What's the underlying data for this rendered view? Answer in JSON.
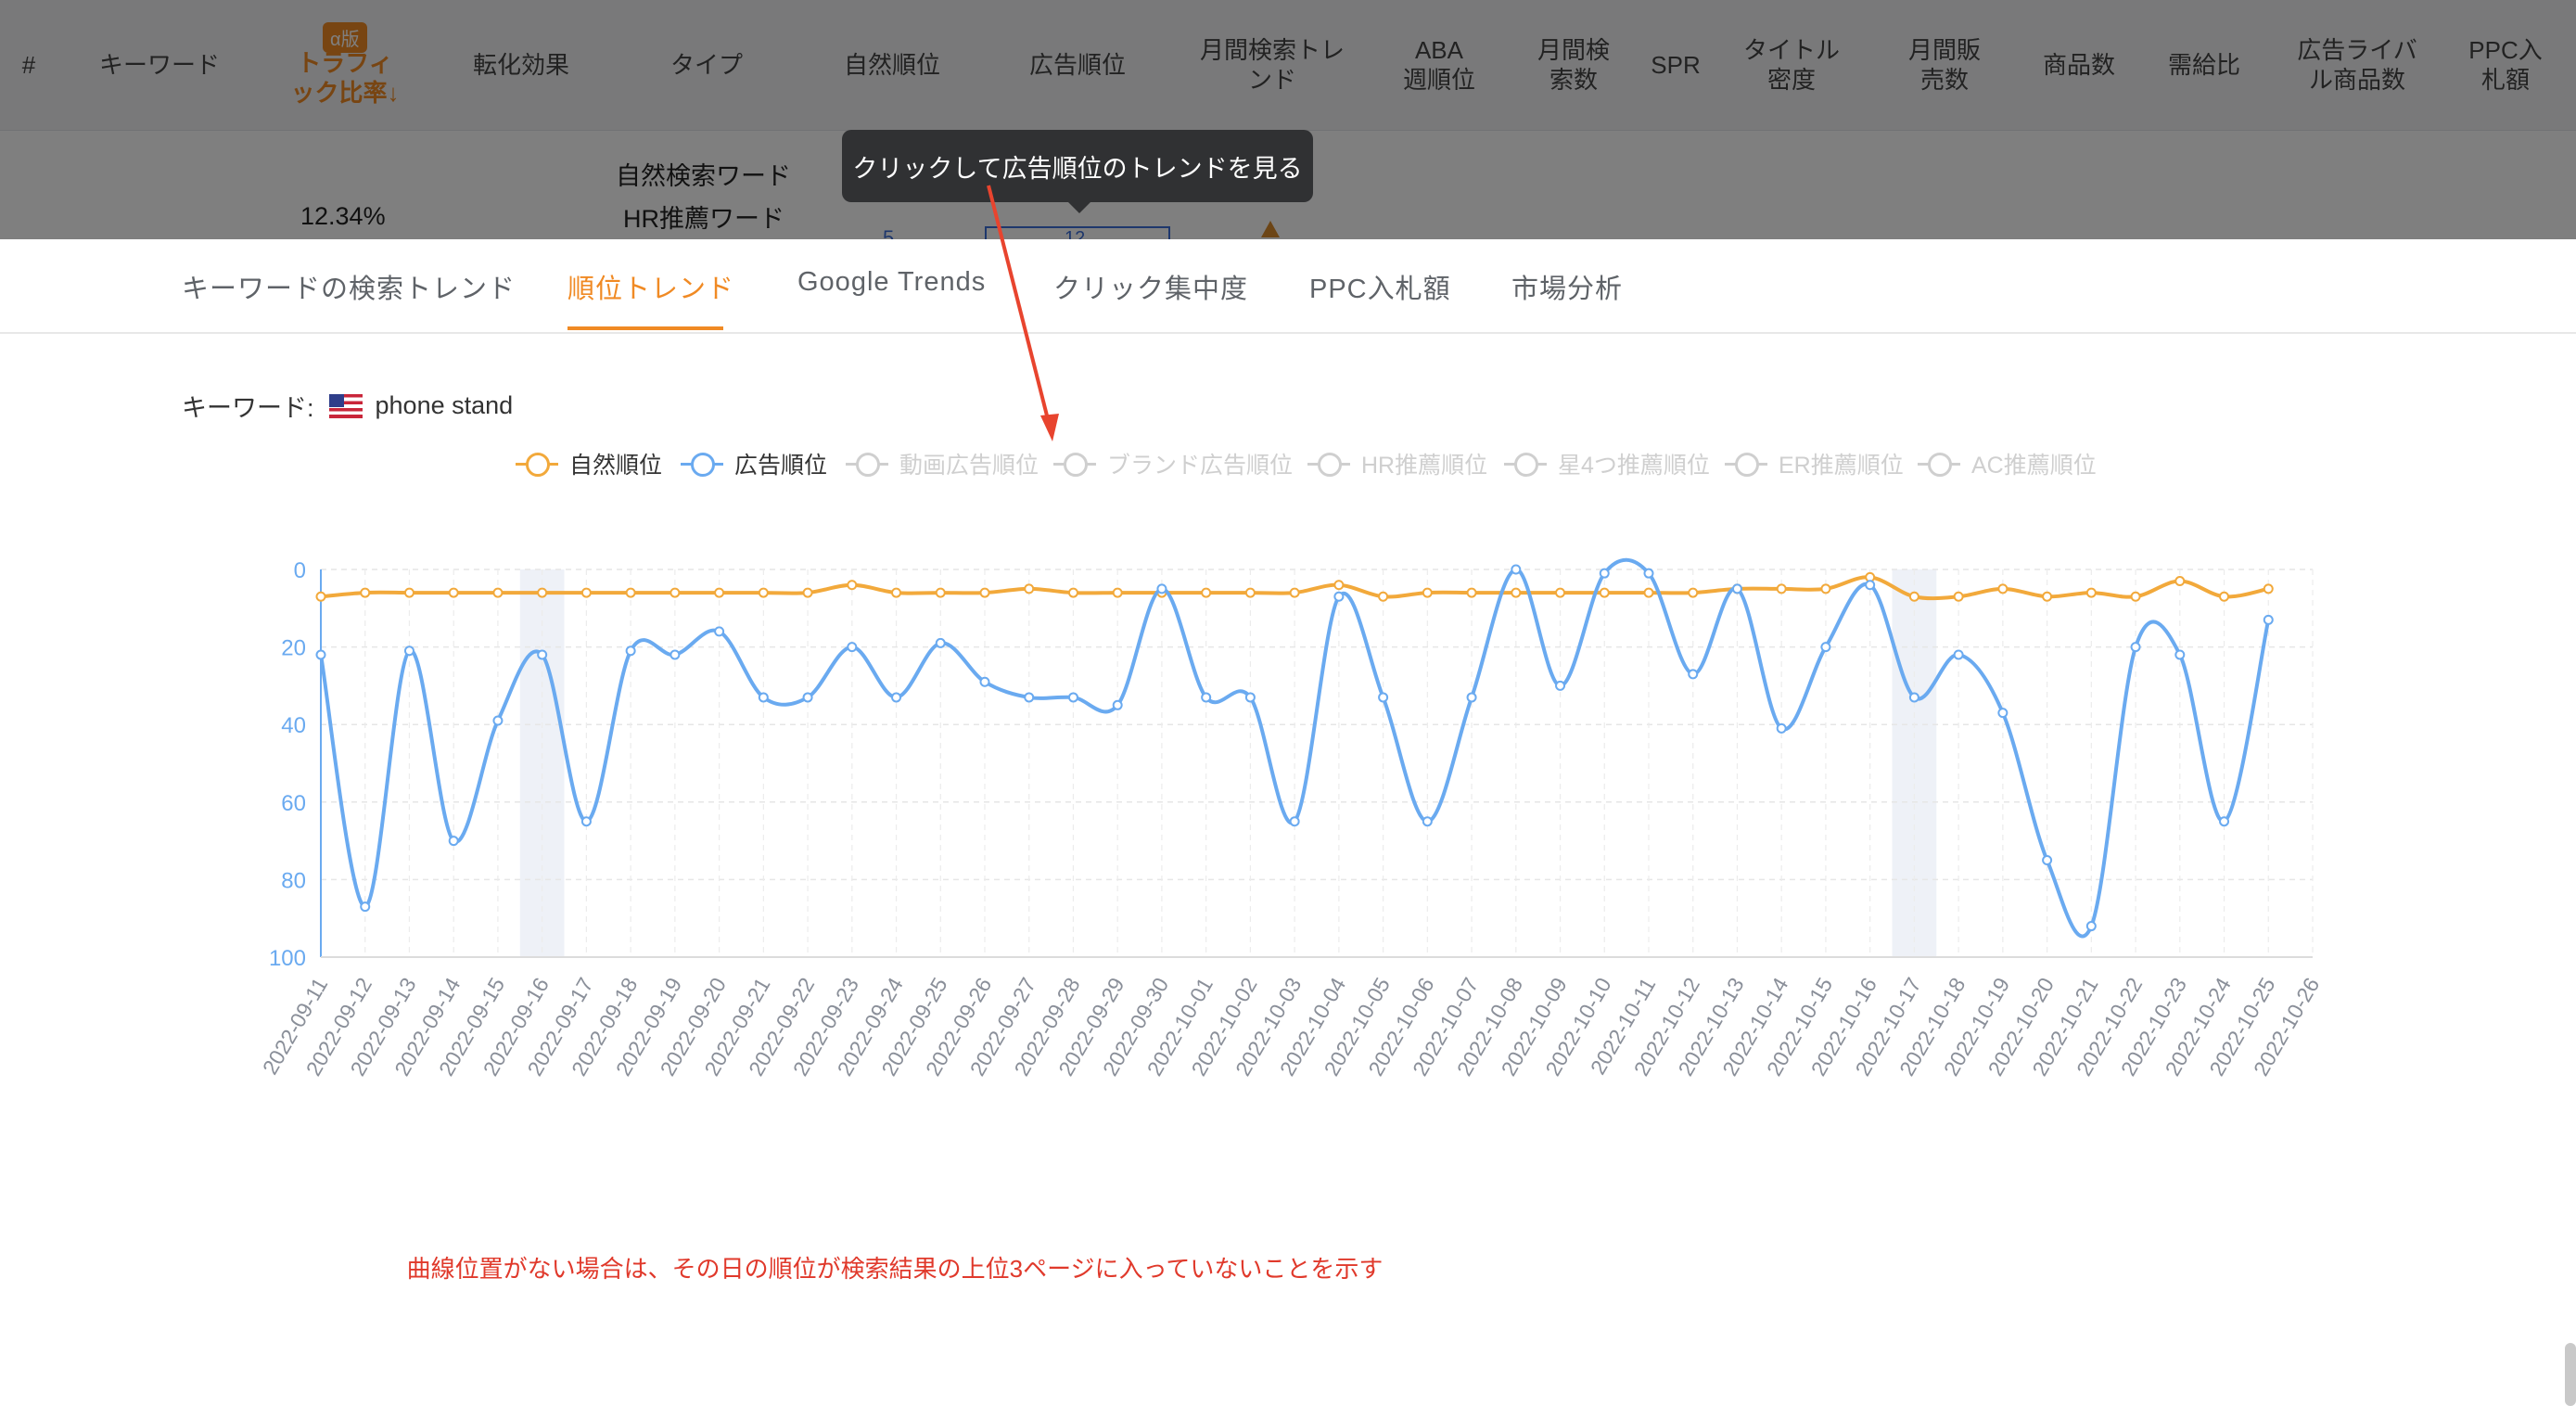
{
  "table_header": {
    "columns": [
      "#",
      "キーワード",
      "トラフィ\nック比率↓",
      "転化効果",
      "タイプ",
      "自然順位",
      "広告順位",
      "月間検索トレ\nンド",
      "ABA\n週順位",
      "月間検\n索数",
      "SPR",
      "タイトル\n密度",
      "月間販\n売数",
      "商品数",
      "需給比",
      "広告ライバ\nル商品数",
      "PPC入\n札額"
    ],
    "alpha_badge": "α版"
  },
  "table_row": {
    "traffic_ratio": "12.34%",
    "type_natural": "自然検索ワード",
    "type_hr": "HR推薦ワード",
    "natural_rank_partial": "5",
    "ad_rank_partial": "12"
  },
  "tooltip": "クリックして広告順位のトレンドを見る",
  "tabs": [
    "キーワードの検索トレンド",
    "順位トレンド",
    "Google Trends",
    "クリック集中度",
    "PPC入札額",
    "市場分析"
  ],
  "active_tab": 1,
  "keyword": {
    "label": "キーワード:",
    "value": "phone stand"
  },
  "legend": [
    {
      "name": "自然順位",
      "color": "#f2a93b",
      "active": true
    },
    {
      "name": "広告順位",
      "color": "#6aaaf0",
      "active": true
    },
    {
      "name": "動画広告順位",
      "color": "#cfcfcf",
      "active": false
    },
    {
      "name": "ブランド広告順位",
      "color": "#cfcfcf",
      "active": false
    },
    {
      "name": "HR推薦順位",
      "color": "#cfcfcf",
      "active": false
    },
    {
      "name": "星4つ推薦順位",
      "color": "#cfcfcf",
      "active": false
    },
    {
      "name": "ER推薦順位",
      "color": "#cfcfcf",
      "active": false
    },
    {
      "name": "AC推薦順位",
      "color": "#cfcfcf",
      "active": false
    }
  ],
  "chart_data": {
    "type": "line",
    "y_inverse": true,
    "ylim": [
      0,
      100
    ],
    "yticks": [
      0,
      20,
      40,
      60,
      80,
      100
    ],
    "x": [
      "2022-09-11",
      "2022-09-12",
      "2022-09-13",
      "2022-09-14",
      "2022-09-15",
      "2022-09-16",
      "2022-09-17",
      "2022-09-18",
      "2022-09-19",
      "2022-09-20",
      "2022-09-21",
      "2022-09-22",
      "2022-09-23",
      "2022-09-24",
      "2022-09-25",
      "2022-09-26",
      "2022-09-27",
      "2022-09-28",
      "2022-09-29",
      "2022-09-30",
      "2022-10-01",
      "2022-10-02",
      "2022-10-03",
      "2022-10-04",
      "2022-10-05",
      "2022-10-06",
      "2022-10-07",
      "2022-10-08",
      "2022-10-09",
      "2022-10-10",
      "2022-10-11",
      "2022-10-12",
      "2022-10-13",
      "2022-10-14",
      "2022-10-15",
      "2022-10-16",
      "2022-10-17",
      "2022-10-18",
      "2022-10-19",
      "2022-10-20",
      "2022-10-21",
      "2022-10-22",
      "2022-10-23",
      "2022-10-24",
      "2022-10-25",
      "2022-10-26"
    ],
    "shaded_dates": [
      "2022-09-16",
      "2022-10-17"
    ],
    "series": [
      {
        "name": "自然順位",
        "color": "#f2a93b",
        "values": [
          7,
          6,
          6,
          6,
          6,
          6,
          6,
          6,
          6,
          6,
          6,
          6,
          4,
          6,
          6,
          6,
          5,
          6,
          6,
          6,
          6,
          6,
          6,
          4,
          7,
          6,
          6,
          6,
          6,
          6,
          6,
          6,
          5,
          5,
          5,
          2,
          7,
          7,
          5,
          7,
          6,
          7,
          3,
          7,
          5,
          null
        ]
      },
      {
        "name": "広告順位",
        "color": "#6aaaf0",
        "values": [
          22,
          87,
          21,
          70,
          39,
          22,
          65,
          21,
          22,
          16,
          33,
          33,
          20,
          33,
          19,
          29,
          33,
          33,
          35,
          5,
          33,
          33,
          65,
          7,
          33,
          65,
          33,
          0,
          30,
          1,
          1,
          27,
          5,
          41,
          20,
          4,
          33,
          22,
          37,
          75,
          92,
          20,
          22,
          65,
          13,
          null
        ]
      }
    ]
  },
  "note": "曲線位置がない場合は、その日の順位が検索結果の上位3ページに入っていないことを示す",
  "colors": {
    "accent": "#f08a24",
    "natural": "#f2a93b",
    "ad": "#6aaaf0",
    "note": "#e0392b",
    "arrow": "#e8442e"
  }
}
